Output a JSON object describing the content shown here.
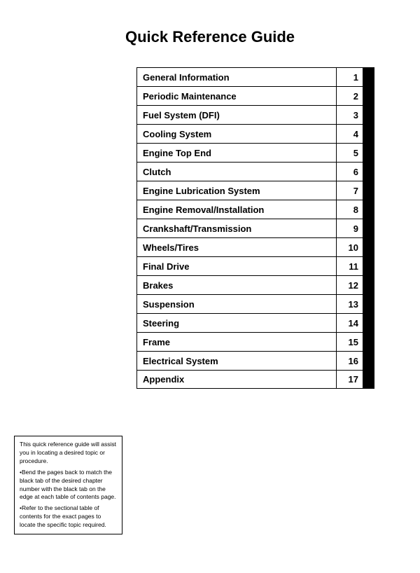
{
  "page": {
    "title": "Quick Reference Guide"
  },
  "toc": {
    "items": [
      {
        "label": "General Information",
        "number": "1"
      },
      {
        "label": "Periodic Maintenance",
        "number": "2"
      },
      {
        "label": "Fuel System (DFI)",
        "number": "3"
      },
      {
        "label": "Cooling System",
        "number": "4"
      },
      {
        "label": "Engine Top End",
        "number": "5"
      },
      {
        "label": "Clutch",
        "number": "6"
      },
      {
        "label": "Engine Lubrication System",
        "number": "7"
      },
      {
        "label": "Engine Removal/Installation",
        "number": "8"
      },
      {
        "label": "Crankshaft/Transmission",
        "number": "9"
      },
      {
        "label": "Wheels/Tires",
        "number": "10"
      },
      {
        "label": "Final Drive",
        "number": "11"
      },
      {
        "label": "Brakes",
        "number": "12"
      },
      {
        "label": "Suspension",
        "number": "13"
      },
      {
        "label": "Steering",
        "number": "14"
      },
      {
        "label": "Frame",
        "number": "15"
      },
      {
        "label": "Electrical System",
        "number": "16"
      },
      {
        "label": "Appendix",
        "number": "17"
      }
    ]
  },
  "note": {
    "line1": "This quick reference guide will assist you in locating a desired topic or procedure.",
    "line2": "•Bend the pages back to match the black tab of the desired chapter number with the black tab on the edge at each table of contents page.",
    "line3": "•Refer to the sectional table of contents for the exact pages to locate the specific topic required."
  }
}
